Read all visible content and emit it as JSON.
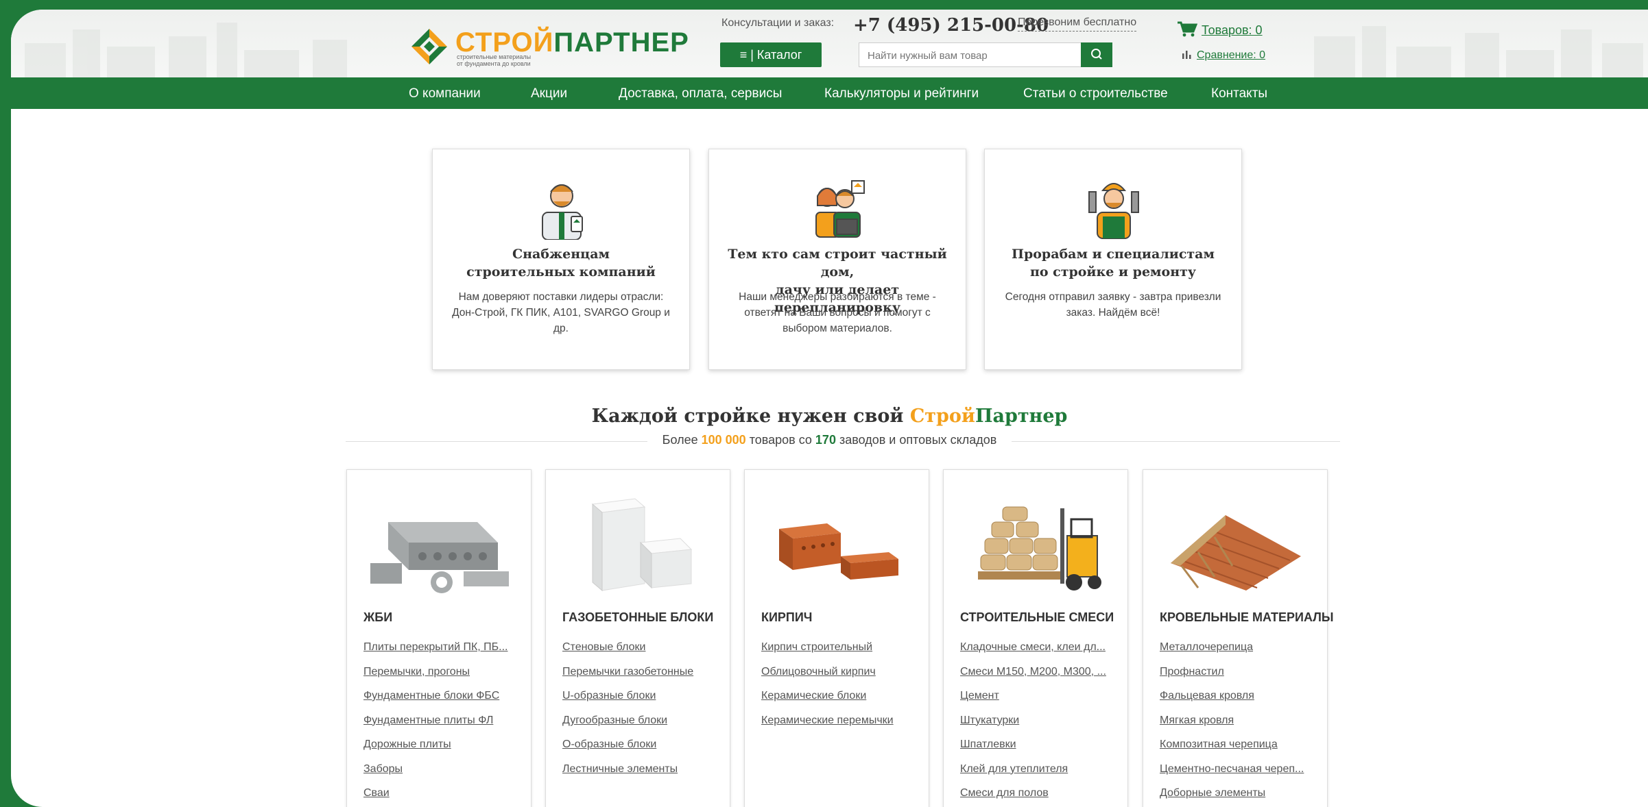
{
  "brand": {
    "name_part1": "СТРОЙ",
    "name_part2": "ПАРТНЕР",
    "subtitle_line1": "строительные материалы",
    "subtitle_line2": "от фундамента до кровли",
    "colors": {
      "green": "#1f7a3a",
      "orange": "#f3a01c"
    }
  },
  "header": {
    "consult_label": "Консультации и заказ:",
    "phone": "+7 (495) 215-00-80",
    "callback_label": "Перезвоним бесплатно",
    "catalog_label": "≡ | Каталог",
    "search_placeholder": "Найти нужный вам товар",
    "search_icon": "search-icon",
    "cart_label": "Товаров: 0",
    "compare_label": "Сравнение: 0"
  },
  "nav": {
    "items": [
      "О компании",
      "Акции",
      "Доставка, оплата, сервисы",
      "Калькуляторы и рейтинги",
      "Статьи о строительстве",
      "Контакты"
    ]
  },
  "audience": [
    {
      "title_line1": "Снабженцам",
      "title_line2": "строительных компаний",
      "text": "Нам доверяют поставки лидеры отрасли: Дон-Строй, ГК ПИК, А101, SVARGO Group и др."
    },
    {
      "title_line1": "Тем кто сам строит частный дом,",
      "title_line2": "дачу или делает перепланировку",
      "text": "Наши менеджеры разбираются в теме - ответят на Ваши вопросы и помогут с выбором материалов."
    },
    {
      "title_line1": "Прорабам и специалистам",
      "title_line2": "по стройке и ремонту",
      "text": "Сегодня отправил заявку - завтра привезли заказ. Найдём всё!"
    }
  ],
  "slogan": {
    "prefix": "Каждой стройке нужен свой ",
    "brand_a": "Строй",
    "brand_b": "Партнер",
    "sub_before": "Более ",
    "sub_count": "100 000",
    "sub_middle": " товаров со ",
    "sub_factories": "170",
    "sub_after": " заводов и оптовых складов"
  },
  "categories": [
    {
      "title": "ЖБИ",
      "links": [
        "Плиты перекрытий ПК, ПБ...",
        "Перемычки, прогоны",
        "Фундаментные блоки ФБС",
        "Фундаментные плиты ФЛ",
        "Дорожные плиты",
        "Заборы",
        "Сваи"
      ]
    },
    {
      "title": "ГАЗОБЕТОННЫЕ БЛОКИ",
      "links": [
        "Стеновые блоки",
        "Перемычки газобетонные",
        "U-образные блоки",
        "Дугообразные блоки",
        "О-образные блоки",
        "Лестничные элементы"
      ]
    },
    {
      "title": "КИРПИЧ",
      "links": [
        "Кирпич строительный",
        "Облицовочный кирпич",
        "Керамические блоки",
        "Керамические перемычки"
      ]
    },
    {
      "title": "СТРОИТЕЛЬНЫЕ СМЕСИ",
      "links": [
        "Кладочные смеси, клеи дл...",
        "Смеси М150, М200, М300, ...",
        "Цемент",
        "Штукатурки",
        "Шпатлевки",
        "Клей для утеплителя",
        "Смеси для полов"
      ]
    },
    {
      "title": "КРОВЕЛЬНЫЕ МАТЕРИАЛЫ",
      "links": [
        "Металлочерепица",
        "Профнастил",
        "Фальцевая кровля",
        "Мягкая кровля",
        "Композитная черепица",
        "Цементно-песчаная череп...",
        "Доборные элементы"
      ]
    }
  ]
}
